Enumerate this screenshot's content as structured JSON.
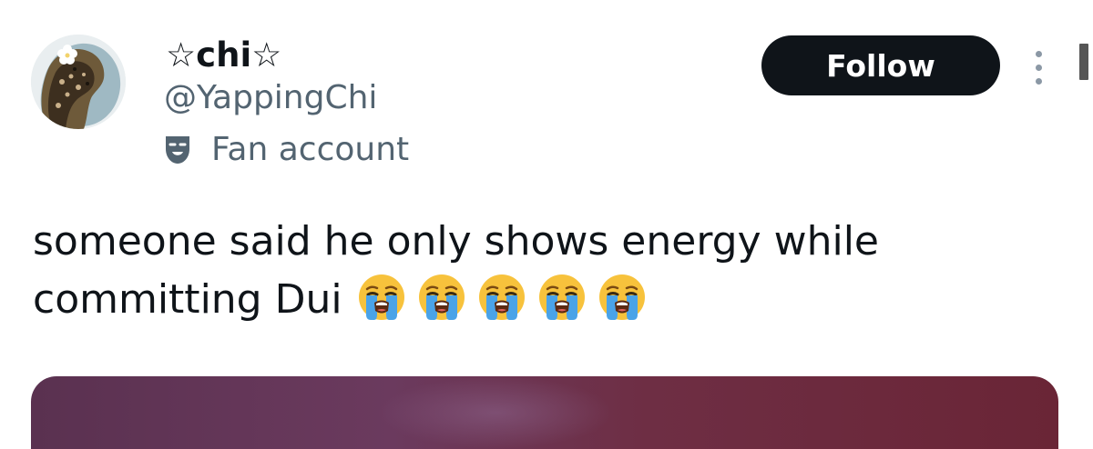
{
  "user": {
    "display_name": "☆chi☆",
    "handle": "@YappingChi",
    "account_label": "Fan account",
    "avatar_icon": "leopard-avatar-icon",
    "label_icon": "theater-mask-icon"
  },
  "actions": {
    "follow_label": "Follow",
    "more_icon": "more-vertical-icon"
  },
  "tweet": {
    "text_line1": "someone said he only shows energy while",
    "text_line2": "committing Dui",
    "emoji_count": 5,
    "emoji": "loudly-crying-face"
  },
  "colors": {
    "text_primary": "#0f1419",
    "text_secondary": "#536471",
    "follow_bg": "#0f1419",
    "follow_text": "#ffffff"
  }
}
